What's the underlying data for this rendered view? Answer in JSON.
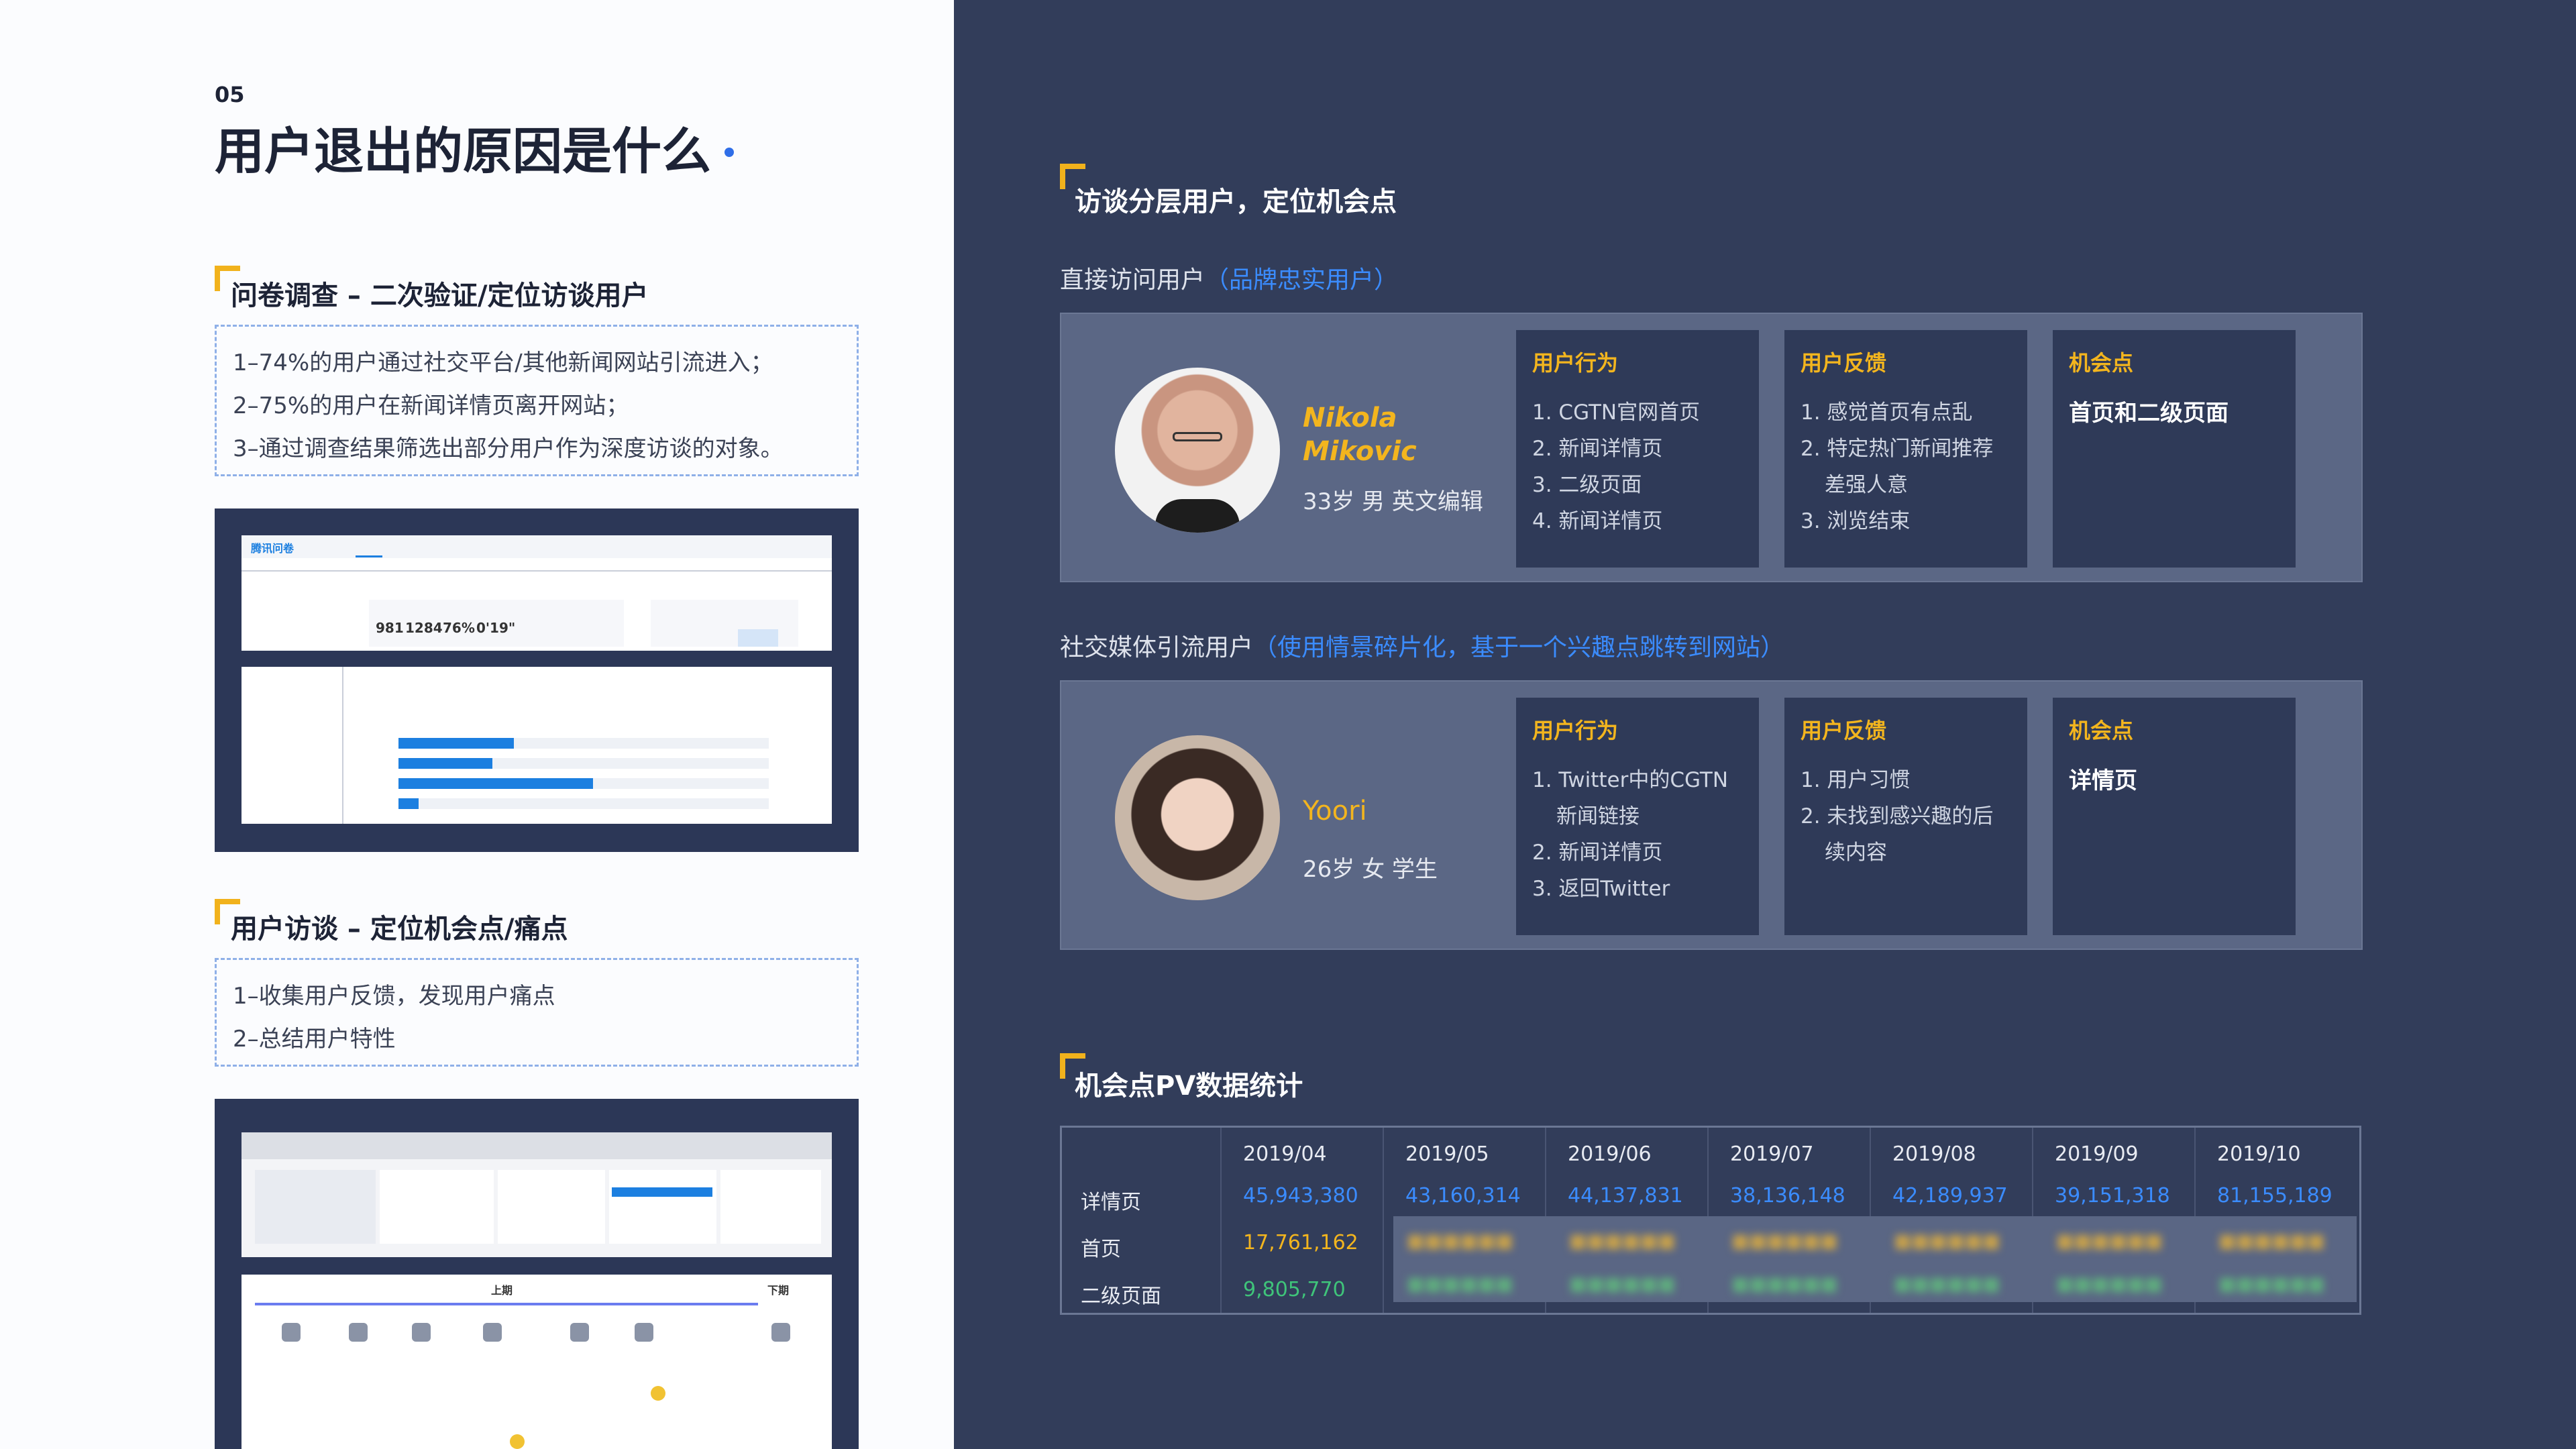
{
  "left": {
    "slide_number": "05",
    "title": "用户退出的原因是什么",
    "survey": {
      "heading": "问卷调查 – 二次验证/定位访谈用户",
      "items": [
        "1–74%的用户通过社交平台/其他新闻网站引流进入；",
        "2–75%的用户在新闻详情页离开网站；",
        "3–通过调查结果筛选出部分用户作为深度访谈的对象。"
      ]
    },
    "survey_screenshot": {
      "app_name": "腾讯问卷",
      "stats": [
        "981",
        "1284",
        "76%",
        "0'19\""
      ]
    },
    "interview": {
      "heading": "用户访谈 – 定位机会点/痛点",
      "items": [
        "1–收集用户反馈，发现用户痛点",
        "2–总结用户特性"
      ]
    },
    "interview_screenshot": {
      "columns": [
        "上期",
        "下期"
      ]
    }
  },
  "right": {
    "section1_title": "访谈分层用户，定位机会点",
    "direct_users": {
      "label": "直接访问用户",
      "note": "（品牌忠实用户）",
      "person": {
        "name_line1": "Nikola",
        "name_line2": "Mikovic",
        "info": "33岁 男 英文编辑"
      },
      "behavior": {
        "title": "用户行为",
        "items": [
          "1. CGTN官网首页",
          "2. 新闻详情页",
          "3. 二级页面",
          "4. 新闻详情页"
        ]
      },
      "feedback": {
        "title": "用户反馈",
        "items": [
          "1. 感觉首页有点乱",
          "2. 特定热门新闻推荐差强人意",
          "3. 浏览结束"
        ]
      },
      "opportunity": {
        "title": "机会点",
        "value": "首页和二级页面"
      }
    },
    "social_users": {
      "label": "社交媒体引流用户",
      "note": "（使用情景碎片化，基于一个兴趣点跳转到网站）",
      "person": {
        "name_line1": "Yoori",
        "info": "26岁 女 学生"
      },
      "behavior": {
        "title": "用户行为",
        "items": [
          "1. Twitter中的CGTN新闻链接",
          "2. 新闻详情页",
          "3. 返回Twitter"
        ]
      },
      "feedback": {
        "title": "用户反馈",
        "items": [
          "1. 用户习惯",
          "2. 未找到感兴趣的后续内容"
        ]
      },
      "opportunity": {
        "title": "机会点",
        "value": "详情页"
      }
    },
    "section2_title": "机会点PV数据统计",
    "pv_table": {
      "columns": [
        "2019/04",
        "2019/05",
        "2019/06",
        "2019/07",
        "2019/08",
        "2019/09",
        "2019/10"
      ],
      "rows": [
        {
          "label": "详情页",
          "values": [
            "45,943,380",
            "43,160,314",
            "44,137,831",
            "38,136,148",
            "42,189,937",
            "39,151,318",
            "81,155,189"
          ]
        },
        {
          "label": "首页",
          "values": [
            "17,761,162"
          ]
        },
        {
          "label": "二级页面",
          "values": [
            "9,805,770"
          ]
        }
      ]
    },
    "colors": {
      "accent": "#f3b51e",
      "blue": "#3b8cff",
      "orange_value": "#f3b51e",
      "green_value": "#3fc47a"
    }
  }
}
